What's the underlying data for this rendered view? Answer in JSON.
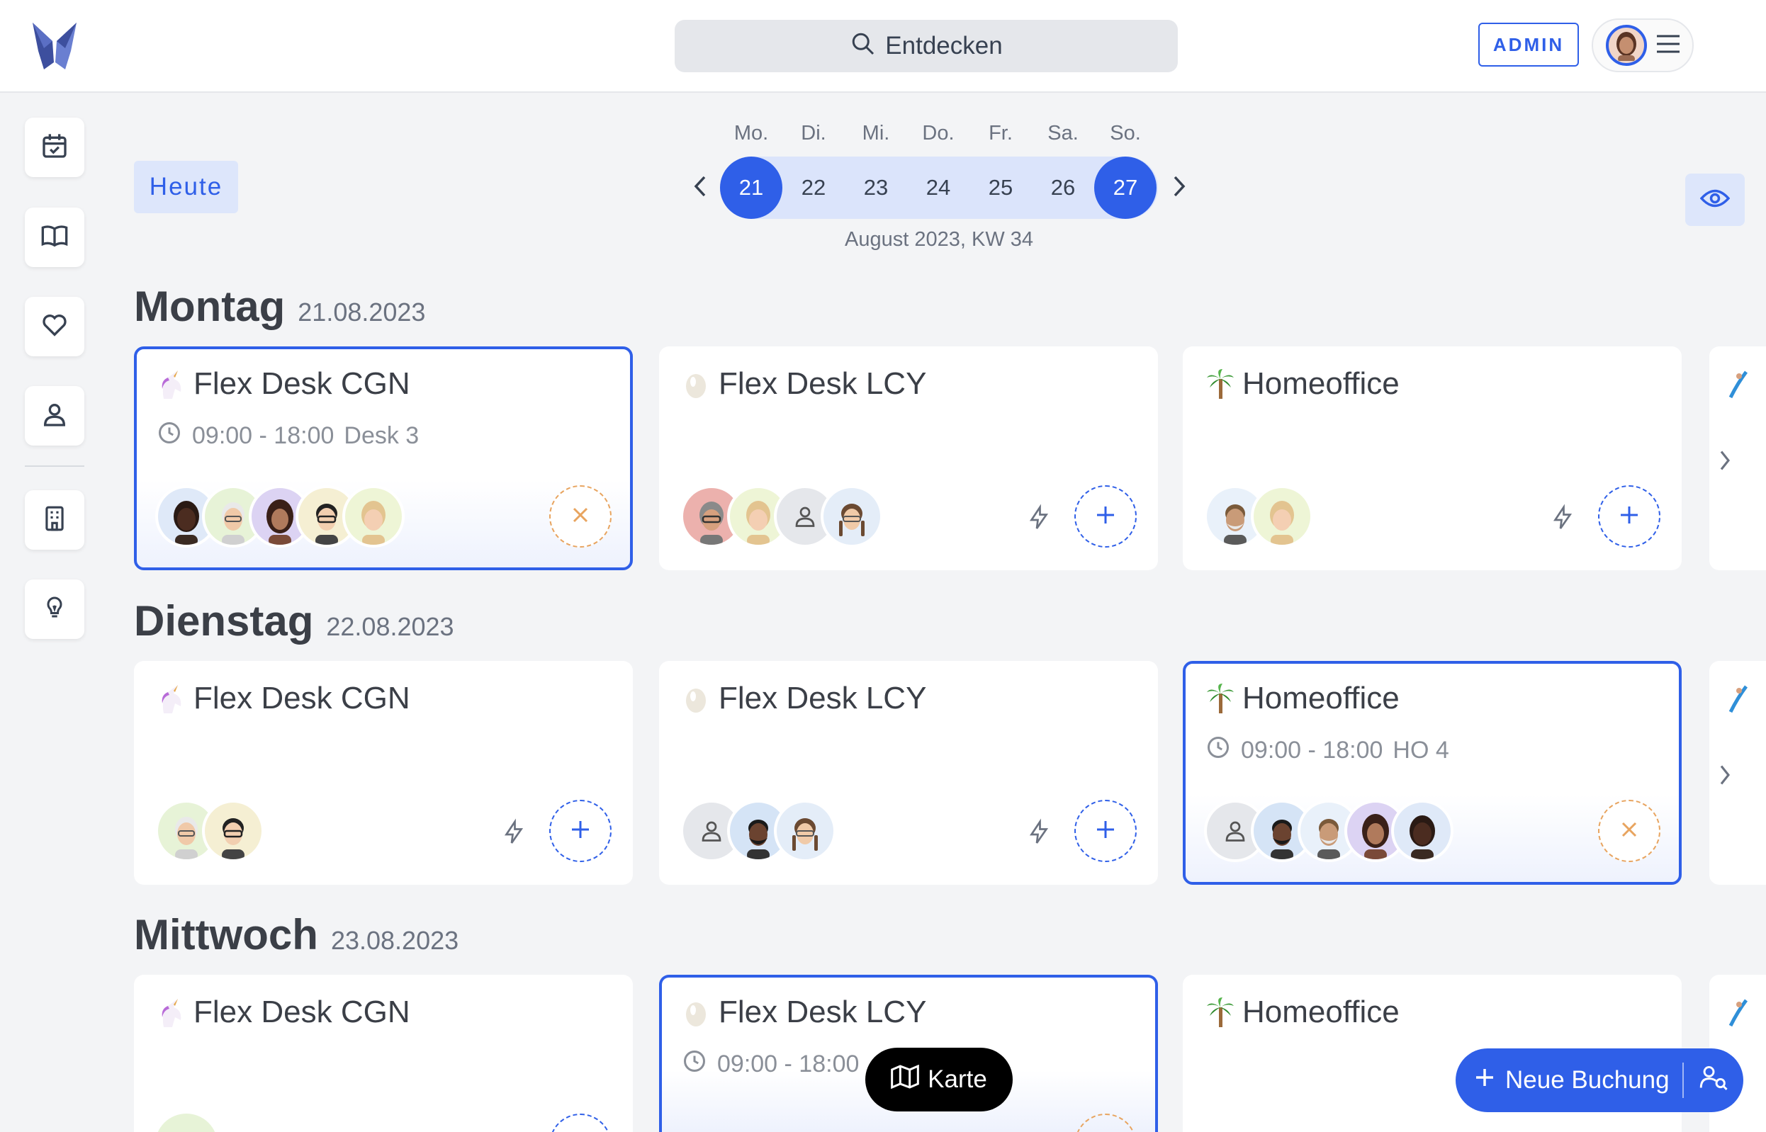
{
  "header": {
    "search_label": "Entdecken",
    "admin_label": "ADMIN"
  },
  "sidebar": {
    "items": [
      {
        "icon": "calendar-check-icon"
      },
      {
        "icon": "book-open-icon"
      },
      {
        "icon": "heart-icon"
      },
      {
        "icon": "user-icon"
      },
      {
        "icon": "building-icon"
      },
      {
        "icon": "lightbulb-icon"
      }
    ]
  },
  "week": {
    "today_label": "Heute",
    "days": [
      {
        "dow": "Mo.",
        "num": "21",
        "selected": true
      },
      {
        "dow": "Di.",
        "num": "22",
        "selected": false
      },
      {
        "dow": "Mi.",
        "num": "23",
        "selected": false
      },
      {
        "dow": "Do.",
        "num": "24",
        "selected": false
      },
      {
        "dow": "Fr.",
        "num": "25",
        "selected": false
      },
      {
        "dow": "Sa.",
        "num": "26",
        "selected": false
      },
      {
        "dow": "So.",
        "num": "27",
        "selected": true
      }
    ],
    "label": "August 2023, KW 34"
  },
  "days": [
    {
      "title": "Montag",
      "date": "21.08.2023",
      "cards": [
        {
          "name": "Flex Desk CGN",
          "emoji": "unicorn",
          "booked": true,
          "time": "09:00 - 18:00",
          "desk": "Desk 3",
          "avatars": 5
        },
        {
          "name": "Flex Desk LCY",
          "emoji": "egg",
          "booked": false,
          "avatars": 4
        },
        {
          "name": "Homeoffice",
          "emoji": "palm",
          "booked": false,
          "avatars": 2
        }
      ]
    },
    {
      "title": "Dienstag",
      "date": "22.08.2023",
      "cards": [
        {
          "name": "Flex Desk CGN",
          "emoji": "unicorn",
          "booked": false,
          "avatars": 2
        },
        {
          "name": "Flex Desk LCY",
          "emoji": "egg",
          "booked": false,
          "avatars": 3
        },
        {
          "name": "Homeoffice",
          "emoji": "palm",
          "booked": true,
          "time": "09:00 - 18:00",
          "desk": "HO 4",
          "avatars": 5
        }
      ]
    },
    {
      "title": "Mittwoch",
      "date": "23.08.2023",
      "cards": [
        {
          "name": "Flex Desk CGN",
          "emoji": "unicorn",
          "booked": false
        },
        {
          "name": "Flex Desk LCY",
          "emoji": "egg",
          "booked": true,
          "time": "09:00 - 18:00"
        },
        {
          "name": "Homeoffice",
          "emoji": "palm",
          "booked": false
        }
      ]
    }
  ],
  "floating": {
    "map_label": "Karte",
    "new_booking_label": "Neue Buchung"
  },
  "colors": {
    "accent": "#2f5fe8",
    "accent_light": "#dde6fb",
    "cancel": "#e8a45f",
    "background": "#f3f4f6"
  }
}
